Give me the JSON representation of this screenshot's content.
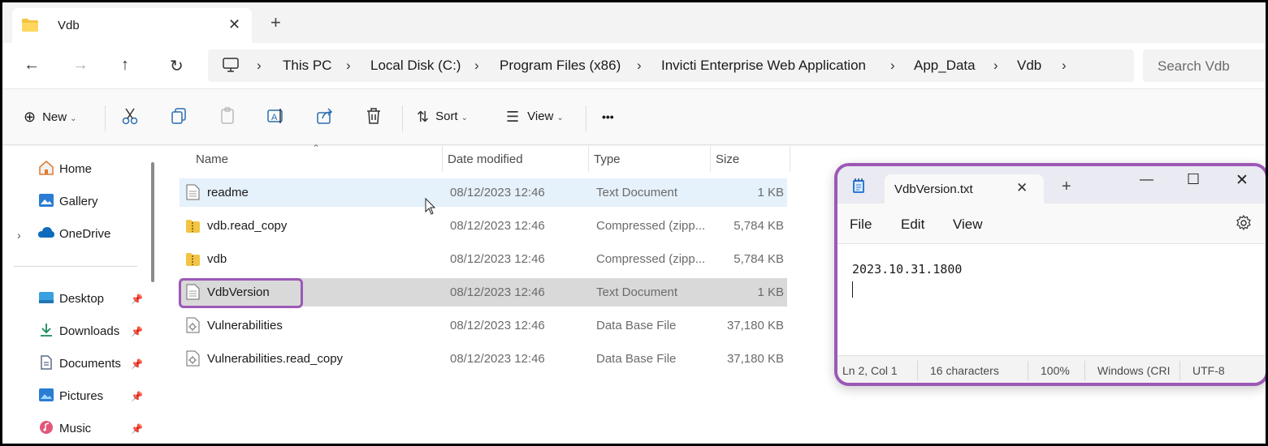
{
  "explorer": {
    "tab_title": "Vdb",
    "tab_close": "✕",
    "new_tab": "+",
    "breadcrumb": [
      "This PC",
      "Local Disk (C:)",
      "Program Files (x86)",
      "Invicti Enterprise Web Application",
      "App_Data",
      "Vdb"
    ],
    "search_placeholder": "Search Vdb",
    "commands": {
      "new_label": "New",
      "sort_label": "Sort",
      "view_label": "View",
      "more_label": "•••"
    },
    "nav": {
      "home": "Home",
      "gallery": "Gallery",
      "onedrive": "OneDrive",
      "desktop": "Desktop",
      "downloads": "Downloads",
      "documents": "Documents",
      "pictures": "Pictures",
      "music": "Music"
    },
    "columns": {
      "name": "Name",
      "date": "Date modified",
      "type": "Type",
      "size": "Size"
    },
    "files": [
      {
        "name": "readme",
        "date": "08/12/2023 12:46",
        "type": "Text Document",
        "size": "1 KB",
        "icon": "text-file-icon"
      },
      {
        "name": "vdb.read_copy",
        "date": "08/12/2023 12:46",
        "type": "Compressed (zipp...",
        "size": "5,784 KB",
        "icon": "zip-folder-icon"
      },
      {
        "name": "vdb",
        "date": "08/12/2023 12:46",
        "type": "Compressed (zipp...",
        "size": "5,784 KB",
        "icon": "zip-folder-icon"
      },
      {
        "name": "VdbVersion",
        "date": "08/12/2023 12:46",
        "type": "Text Document",
        "size": "1 KB",
        "icon": "text-file-icon"
      },
      {
        "name": "Vulnerabilities",
        "date": "08/12/2023 12:46",
        "type": "Data Base File",
        "size": "37,180 KB",
        "icon": "database-file-icon"
      },
      {
        "name": "Vulnerabilities.read_copy",
        "date": "08/12/2023 12:46",
        "type": "Data Base File",
        "size": "37,180 KB",
        "icon": "database-file-icon"
      }
    ],
    "accent_color": "#9b59b6"
  },
  "notepad": {
    "tab_title": "VdbVersion.txt",
    "menu": {
      "file": "File",
      "edit": "Edit",
      "view": "View"
    },
    "content": "2023.10.31.1800",
    "status": {
      "position": "Ln 2, Col 1",
      "chars": "16 characters",
      "zoom": "100%",
      "line_ending": "Windows (CRI",
      "encoding": "UTF-8"
    }
  }
}
